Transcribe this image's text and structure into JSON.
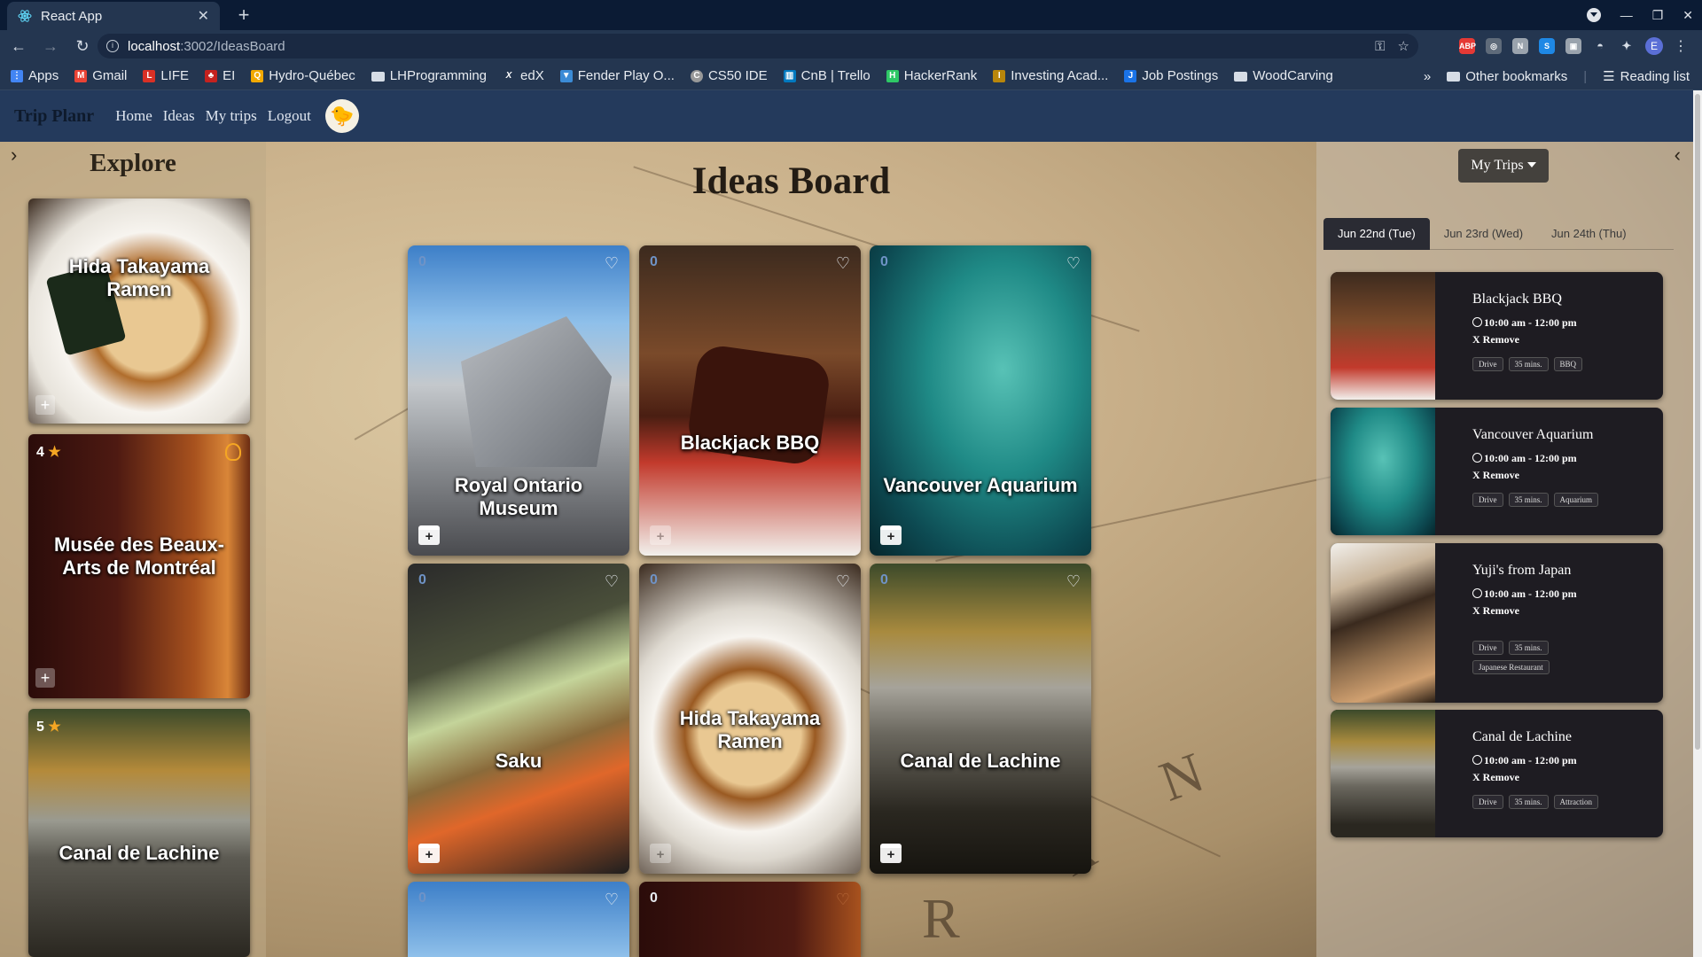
{
  "browser": {
    "tab_title": "React App",
    "url_host": "localhost",
    "url_path": ":3002/IdeasBoard",
    "bookmarks": [
      {
        "label": "Apps",
        "color": "#4285f4"
      },
      {
        "label": "Gmail",
        "color": "#ea4335"
      },
      {
        "label": "LIFE",
        "color": "#d93025"
      },
      {
        "label": "EI",
        "color": "#c5221f"
      },
      {
        "label": "Hydro-Québec",
        "color": "#f2a900"
      },
      {
        "label": "LHProgramming",
        "color": "#d6dde6"
      },
      {
        "label": "edX",
        "color": "#243650"
      },
      {
        "label": "Fender Play O...",
        "color": "#3b8bd6"
      },
      {
        "label": "CS50 IDE",
        "color": "#999999"
      },
      {
        "label": "CnB | Trello",
        "color": "#0079bf"
      },
      {
        "label": "HackerRank",
        "color": "#2ec866"
      },
      {
        "label": "Investing Acad...",
        "color": "#b8860b"
      },
      {
        "label": "Job Postings",
        "color": "#1a73e8"
      },
      {
        "label": "WoodCarving",
        "color": "#d6dde6"
      }
    ],
    "more_bookmarks": "»",
    "other_bookmarks": "Other bookmarks",
    "reading_list": "Reading list",
    "profile_initial": "E"
  },
  "app": {
    "brand": "Trip Planr",
    "nav": [
      "Home",
      "Ideas",
      "My trips",
      "Logout"
    ],
    "avatar_glyph": "🐤"
  },
  "explore": {
    "title": "Explore",
    "items": [
      {
        "title": "Hida Takayama Ramen",
        "rating": "",
        "image": "ramen"
      },
      {
        "title": "Musée des Beaux-Arts de Montréal",
        "rating": "4",
        "image": "museum"
      },
      {
        "title": "Canal de Lachine",
        "rating": "5",
        "image": "canal"
      }
    ]
  },
  "board": {
    "title": "Ideas Board",
    "cards": [
      {
        "title": "Royal Ontario Museum",
        "count": "0",
        "image": "rom"
      },
      {
        "title": "Blackjack BBQ",
        "count": "0",
        "image": "bbq"
      },
      {
        "title": "Vancouver Aquarium",
        "count": "0",
        "image": "aquarium"
      },
      {
        "title": "Saku",
        "count": "0",
        "image": "saku"
      },
      {
        "title": "Hida Takayama Ramen",
        "count": "0",
        "image": "ramen"
      },
      {
        "title": "Canal de Lachine",
        "count": "0",
        "image": "canal"
      },
      {
        "title": "",
        "count": "0",
        "image": "sky"
      },
      {
        "title": "",
        "count": "0",
        "image": "museum"
      }
    ]
  },
  "trips": {
    "button_label": "My Trips",
    "days": [
      "Jun 22nd (Tue)",
      "Jun 23rd (Wed)",
      "Jun 24th (Thu)"
    ],
    "active_day": 0,
    "items": [
      {
        "name": "Blackjack BBQ",
        "time": "10:00 am - 12:00 pm",
        "remove": "X Remove",
        "tags": [
          "Drive",
          "35 mins.",
          "BBQ"
        ],
        "image": "bbq"
      },
      {
        "name": "Vancouver Aquarium",
        "time": "10:00 am - 12:00 pm",
        "remove": "X Remove",
        "tags": [
          "Drive",
          "35 mins.",
          "Aquarium"
        ],
        "image": "aquarium"
      },
      {
        "name": "Yuji's from Japan",
        "time": "10:00 am - 12:00 pm",
        "remove": "X Remove",
        "tags": [
          "Drive",
          "35 mins.",
          "Japanese Restaurant"
        ],
        "image": "yuji"
      },
      {
        "name": "Canal de Lachine",
        "time": "10:00 am - 12:00 pm",
        "remove": "X Remove",
        "tags": [
          "Drive",
          "35 mins.",
          "Attraction"
        ],
        "image": "canal"
      }
    ]
  },
  "icons": {
    "heart": "♡",
    "star": "★",
    "plus": "+",
    "calendar_plus": "+",
    "chevron_right": "›",
    "chevron_left": "‹"
  }
}
